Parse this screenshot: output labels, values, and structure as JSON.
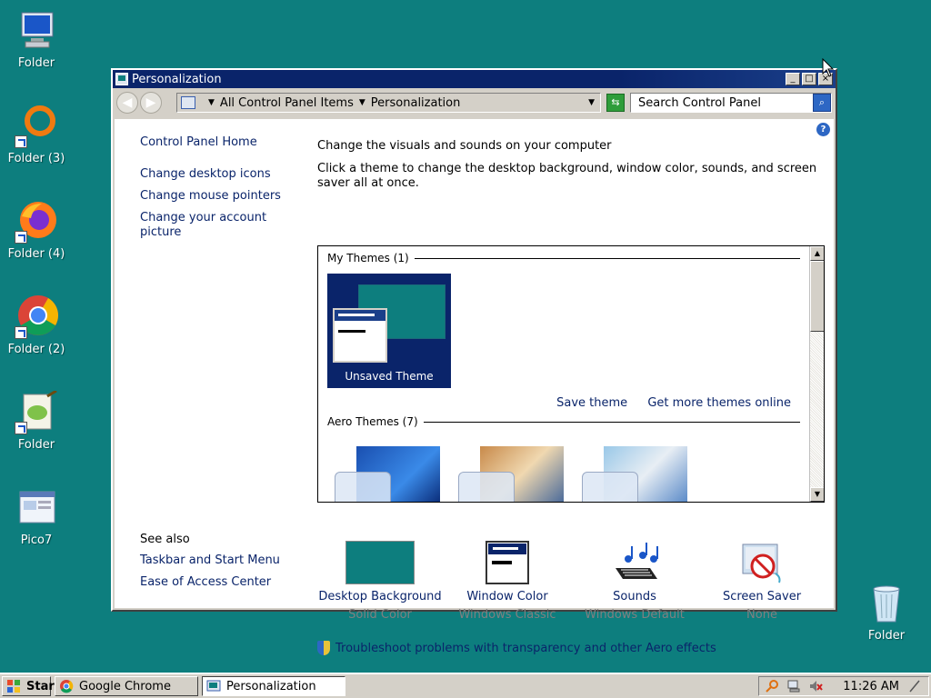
{
  "desktop": {
    "icons": [
      {
        "label": "Folder",
        "icon": "computer-icon"
      },
      {
        "label": "Folder (3)",
        "icon": "orange-ring-icon"
      },
      {
        "label": "Folder (4)",
        "icon": "firefox-icon"
      },
      {
        "label": "Folder (2)",
        "icon": "chrome-icon"
      },
      {
        "label": "Folder",
        "icon": "notepad-icon"
      },
      {
        "label": "Pico7",
        "icon": "document-window-icon"
      },
      {
        "label": "Folder",
        "icon": "recycle-bin-icon"
      }
    ]
  },
  "window": {
    "title": "Personalization",
    "address": {
      "crumb1": "All Control Panel Items",
      "crumb2": "Personalization"
    },
    "search_placeholder": "Search Control Panel",
    "help_label": "?",
    "left_links": {
      "home": "Control Panel Home",
      "items": [
        "Change desktop icons",
        "Change mouse pointers",
        "Change your account picture"
      ]
    },
    "see_also": {
      "heading": "See also",
      "items": [
        "Taskbar and Start Menu",
        "Ease of Access Center"
      ]
    },
    "main": {
      "heading": "Change the visuals and sounds on your computer",
      "description": "Click a theme to change the desktop background, window color, sounds, and screen saver all at once."
    },
    "themes": {
      "my_group": "My Themes (1)",
      "unsaved_label": "Unsaved Theme",
      "save_link": "Save theme",
      "more_link": "Get more themes online",
      "aero_group": "Aero Themes (7)"
    },
    "settings": [
      {
        "name": "Desktop Background",
        "value": "Solid Color",
        "icon": "solid-color-swatch-icon"
      },
      {
        "name": "Window Color",
        "value": "Windows Classic",
        "icon": "window-color-icon"
      },
      {
        "name": "Sounds",
        "value": "Windows Default",
        "icon": "sounds-icon"
      },
      {
        "name": "Screen Saver",
        "value": "None",
        "icon": "screen-saver-icon"
      }
    ],
    "troubleshoot": "Troubleshoot problems with transparency and other Aero effects"
  },
  "taskbar": {
    "start_label": "Start",
    "apps": [
      {
        "label": "Google Chrome",
        "active": false
      },
      {
        "label": "Personalization",
        "active": true
      }
    ],
    "clock": "11:26 AM"
  },
  "colors": {
    "desktop": "#0d7e7e",
    "titlebar": "#0a246a",
    "link": "#0a246a"
  }
}
